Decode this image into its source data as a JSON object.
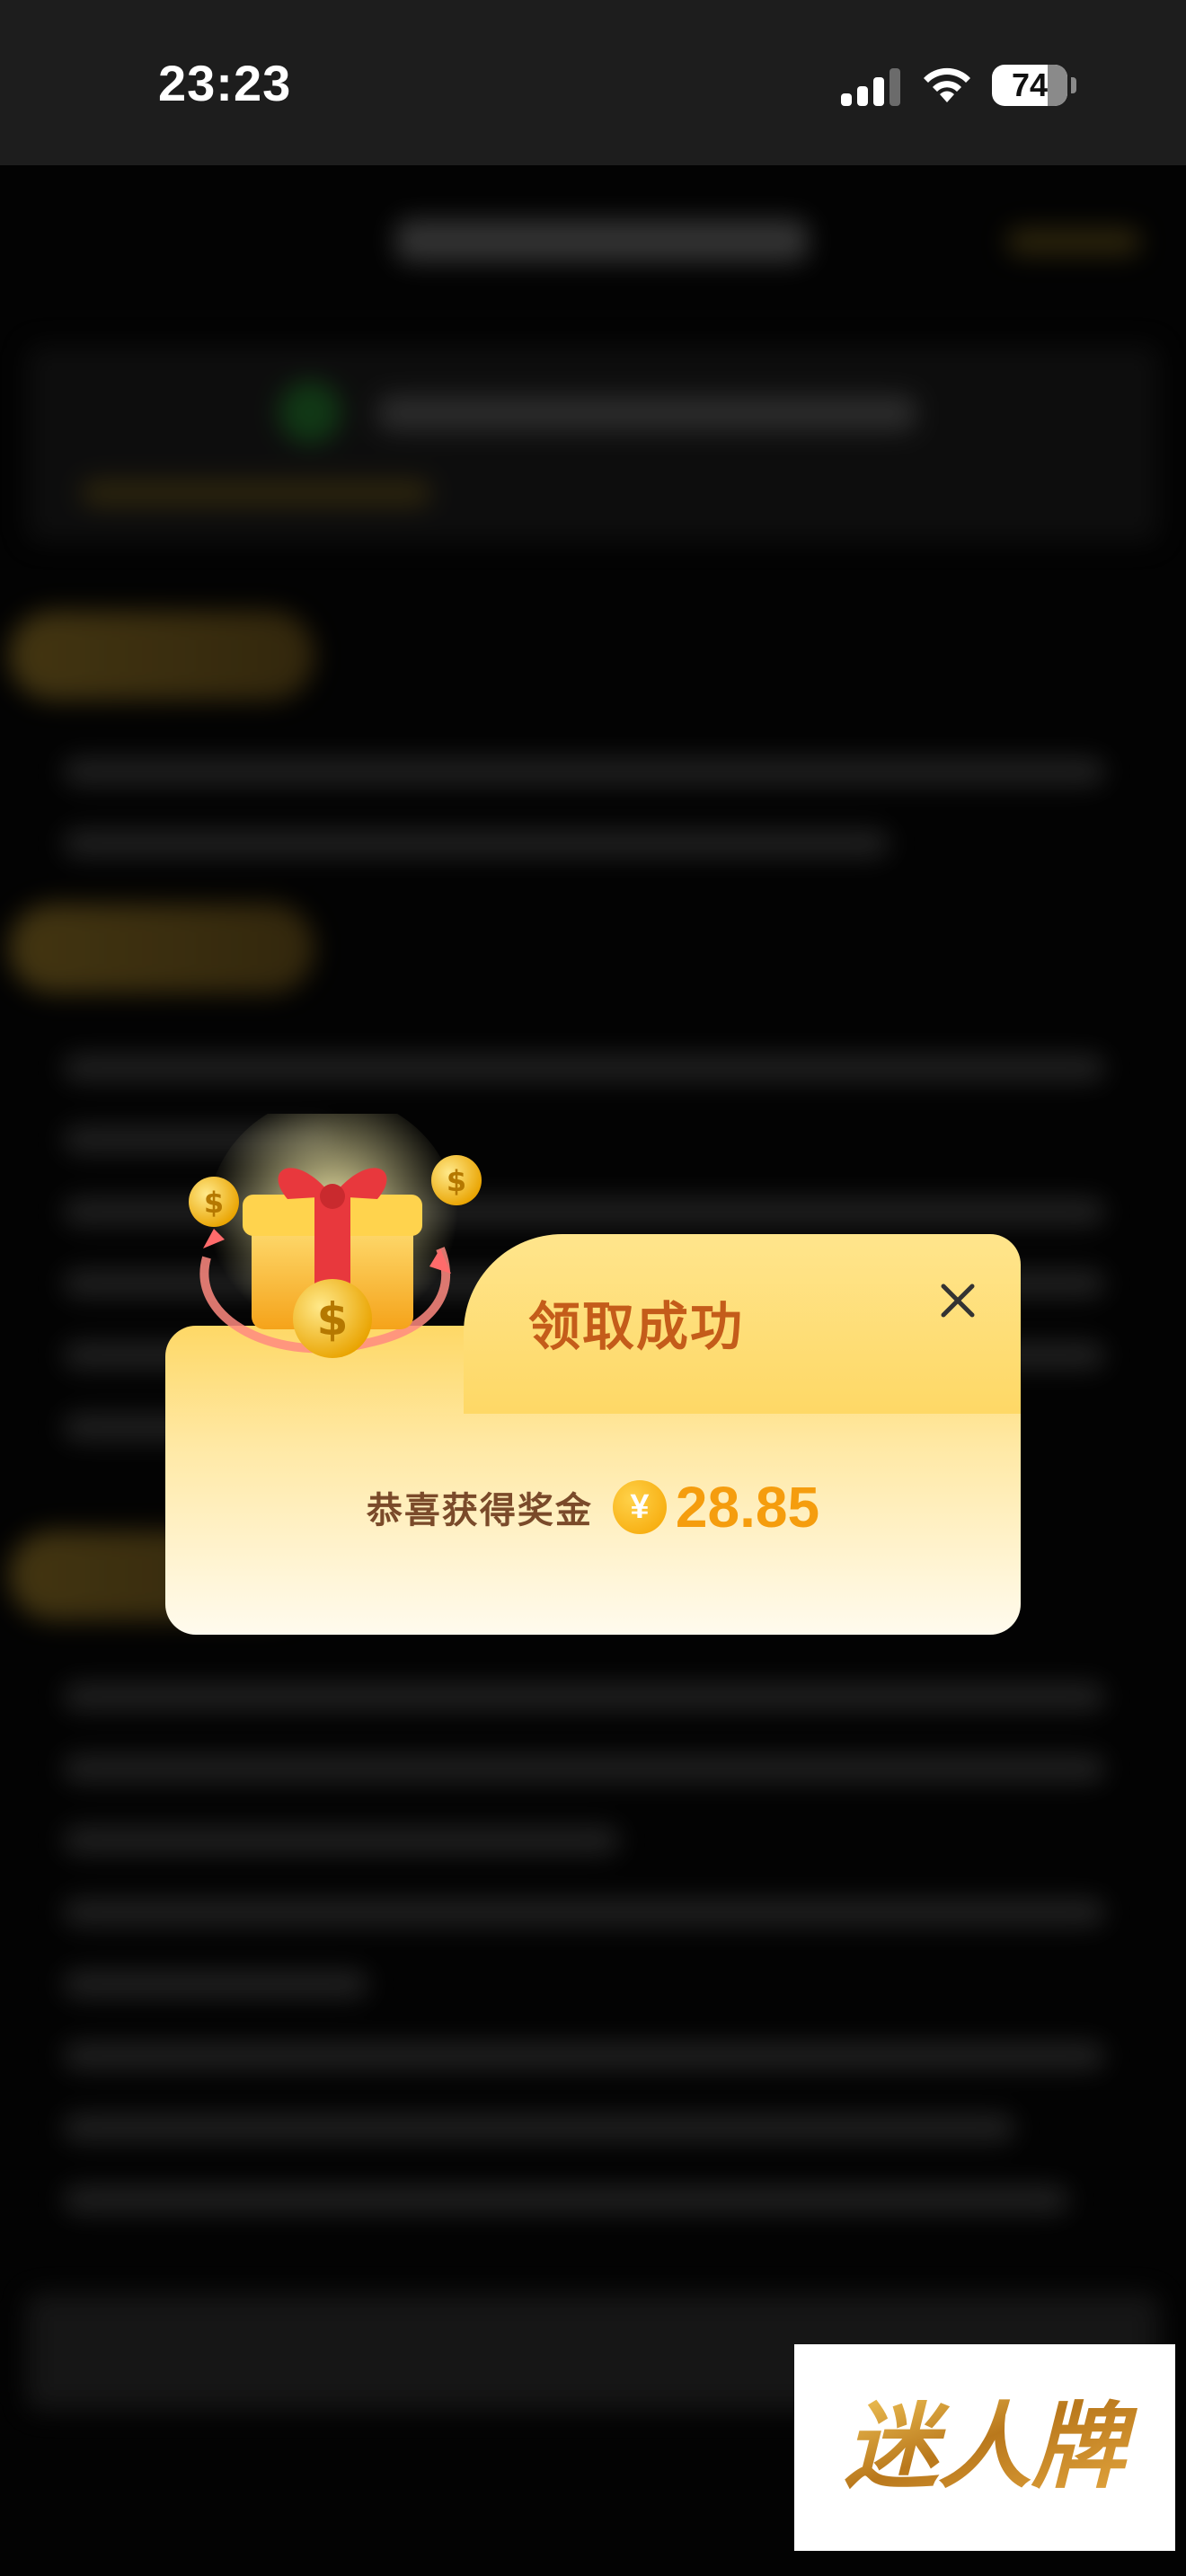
{
  "status_bar": {
    "time": "23:23",
    "battery": "74"
  },
  "dialog": {
    "title": "领取成功",
    "prize_label": "恭喜获得奖金",
    "currency_symbol": "¥",
    "amount": "28.85"
  },
  "brand_logo": {
    "text": "迷人牌"
  },
  "colors": {
    "title": "#c45c1a",
    "amount": "#f59d0e",
    "dialog_top": "#fed866",
    "dialog_bottom": "#fffbee"
  }
}
